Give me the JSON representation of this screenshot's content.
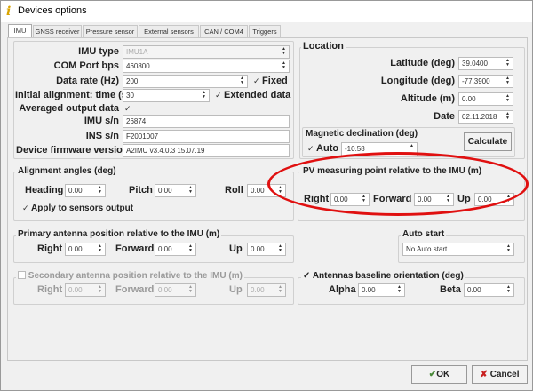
{
  "window": {
    "title": "Devices options",
    "icon": "info-icon"
  },
  "tabs": [
    "IMU",
    "GNSS receiver",
    "Pressure sensor",
    "External sensors",
    "CAN / COM4",
    "Triggers"
  ],
  "imu": {
    "imu_type_label": "IMU type",
    "imu_type": "IMU1A",
    "com_label": "COM Port bps",
    "com": "460800",
    "rate_label": "Data rate (Hz)",
    "rate": "200",
    "fixed": "Fixed",
    "init_label": "Initial alignment: time (s)",
    "init": "30",
    "extended": "Extended data",
    "averaged_label": "Averaged output data",
    "imu_sn_label": "IMU s/n",
    "imu_sn": "26874",
    "ins_sn_label": "INS s/n",
    "ins_sn": "F2001007",
    "fw_label": "Device firmware version",
    "fw": "A2IMU v3.4.0.3 15.07.19"
  },
  "location": {
    "title": "Location",
    "lat_label": "Latitude (deg)",
    "lat": "39.0400",
    "lon_label": "Longitude (deg)",
    "lon": "-77.3900",
    "alt_label": "Altitude (m)",
    "alt": "0.00",
    "date_label": "Date",
    "date": "02.11.2018",
    "mag_title": "Magnetic declination (deg)",
    "auto": "Auto",
    "mag": "-10.58",
    "calculate": "Calculate"
  },
  "alignment": {
    "title": "Alignment angles (deg)",
    "heading": "Heading",
    "heading_v": "0.00",
    "pitch": "Pitch",
    "pitch_v": "0.00",
    "roll": "Roll",
    "roll_v": "0.00",
    "apply": "Apply to sensors output"
  },
  "pv": {
    "title": "PV measuring point relative to the IMU (m)",
    "right": "Right",
    "right_v": "0.00",
    "forward": "Forward",
    "forward_v": "0.00",
    "up": "Up",
    "up_v": "0.00"
  },
  "primary": {
    "title": "Primary antenna position relative to the IMU (m)",
    "right": "Right",
    "right_v": "0.00",
    "forward": "Forward",
    "forward_v": "0.00",
    "up": "Up",
    "up_v": "0.00"
  },
  "autostart": {
    "title": "Auto start",
    "value": "No Auto start"
  },
  "secondary": {
    "title": "Secondary antenna position relative to the IMU (m)",
    "right": "Right",
    "right_v": "0.00",
    "forward": "Forward",
    "forward_v": "0.00",
    "up": "Up",
    "up_v": "0.00"
  },
  "baseline": {
    "title": "Antennas baseline orientation (deg)",
    "alpha": "Alpha",
    "alpha_v": "0.00",
    "beta": "Beta",
    "beta_v": "0.00"
  },
  "buttons": {
    "ok": "OK",
    "cancel": "Cancel"
  },
  "colors": {
    "highlight": "#e01010",
    "window_bg": "#f0f0f0"
  }
}
